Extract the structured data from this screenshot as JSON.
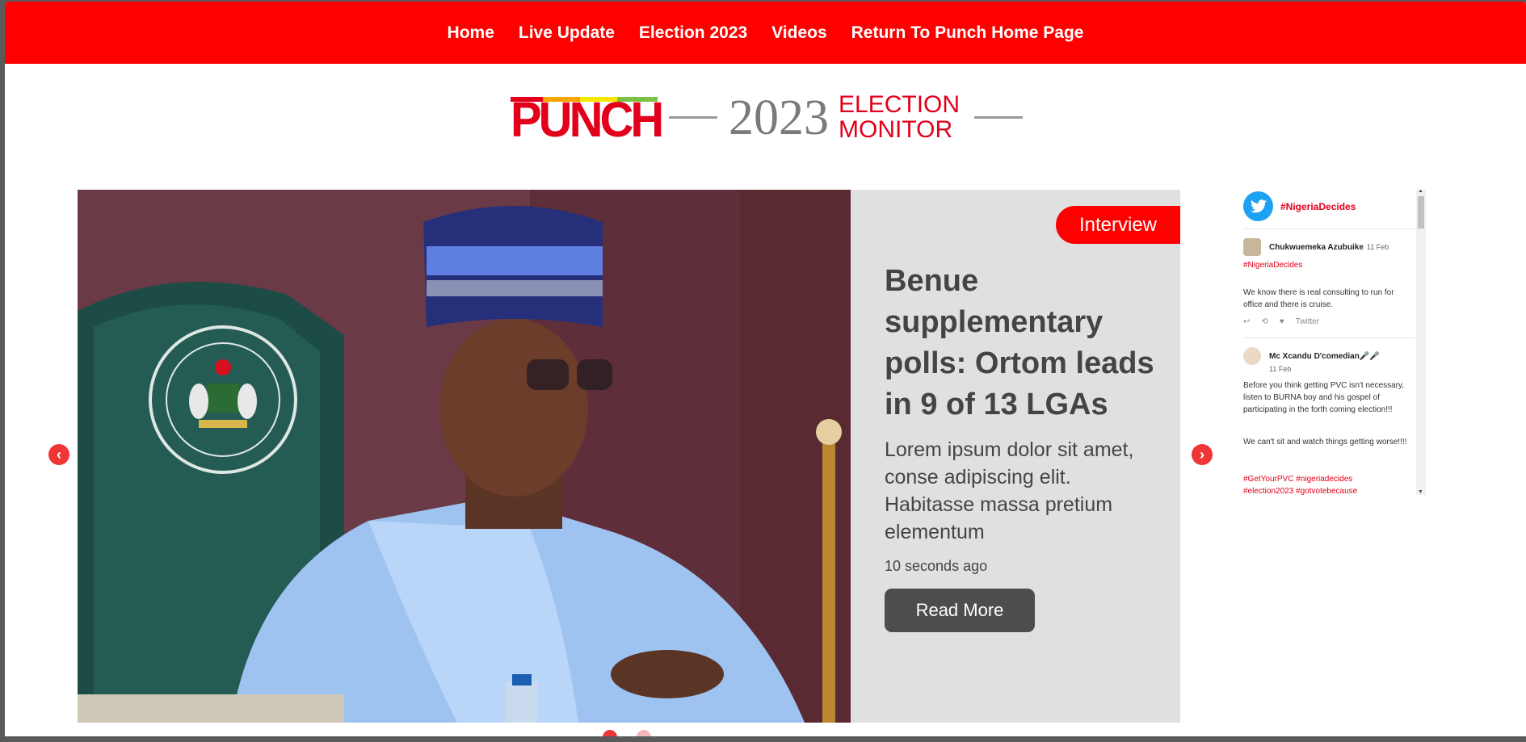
{
  "nav": {
    "items": [
      "Home",
      "Live Update",
      "Election 2023",
      "Videos",
      "Return To Punch Home Page"
    ]
  },
  "logo": {
    "brand": "PUNCH",
    "year": "2023",
    "line1": "ELECTION",
    "line2": "MONITOR"
  },
  "slide": {
    "tag": "Interview",
    "headline": "Benue supplementary polls: Ortom leads in 9 of 13 LGAs",
    "excerpt": "Lorem ipsum dolor sit amet, conse adipiscing elit. Habitasse massa pretium elementum",
    "time": "10 seconds ago",
    "read_more": "Read More"
  },
  "slider": {
    "prev_glyph": "‹",
    "next_glyph": "›",
    "dots": 2,
    "active_dot": 0
  },
  "twitter": {
    "hashtag": "#NigeriaDecides",
    "tweets": [
      {
        "author": "Chukwuemeka Azubuike",
        "date": "11 Feb",
        "hashtag": "#NigeriaDecides",
        "text": "We know there is real consulting to run for office and there is cruise.",
        "source": "Twitter"
      },
      {
        "author": "Mc Xcandu D'comedian🎤🎤",
        "date": "11 Feb",
        "text1": "Before you think getting PVC isn't necessary, listen to BURNA boy and his gospel of participating in the forth coming election!!!",
        "text2": "We can't sit and watch things getting worse!!!!",
        "hashtags": "#GetYourPVC #nigeriadecides",
        "hashtags_more": "#election2023 #gotvotebecause"
      }
    ]
  },
  "colors": {
    "brand_red": "#fe0000",
    "panel_gray": "#e0e0e0",
    "button_dark": "#4d4d4d"
  },
  "icons": [
    "twitter-bird-icon",
    "chevron-left-icon",
    "chevron-right-icon",
    "reply-icon",
    "retweet-icon",
    "heart-icon"
  ]
}
